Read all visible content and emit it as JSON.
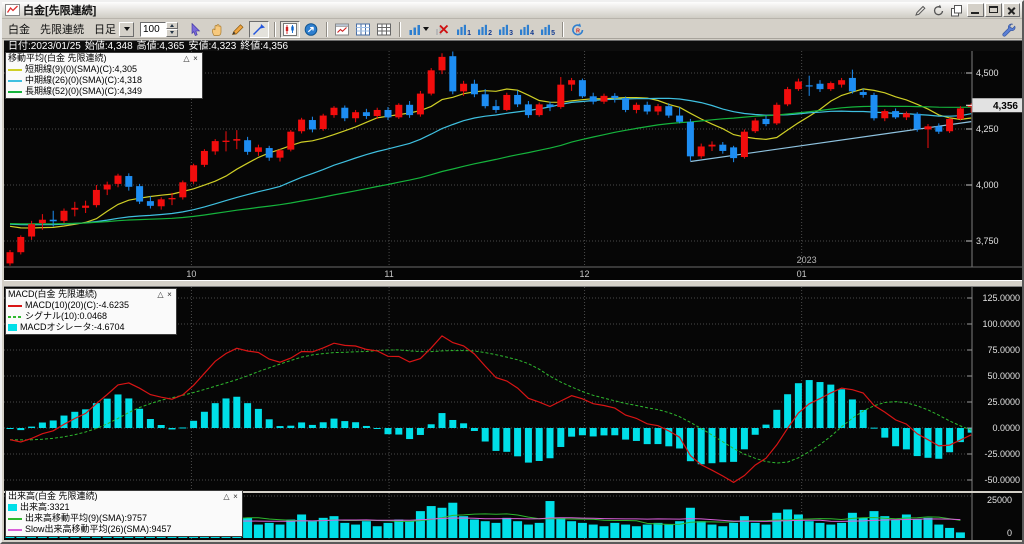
{
  "window": {
    "title": "白金[先限連続]",
    "controls": {
      "minimize": "minimize",
      "maximize": "maximize",
      "close": "close"
    }
  },
  "toolbar": {
    "symbol": "白金",
    "series": "先限連続",
    "period": "日足",
    "bars_count": "100",
    "tools": [
      {
        "name": "cursor-tool",
        "icon": "cursor"
      },
      {
        "name": "hand-pan-tool",
        "icon": "hand"
      },
      {
        "name": "pencil-draw-tool",
        "icon": "pencil"
      },
      {
        "name": "trendline-tool",
        "icon": "trend-arrow",
        "pressed": true
      },
      {
        "sep": true
      },
      {
        "name": "candle-chart-mode",
        "icon": "candle-chart",
        "pressed": true
      },
      {
        "name": "navigate-tool",
        "icon": "circle-arrow"
      },
      {
        "sep": true
      },
      {
        "name": "new-chart-window",
        "icon": "chart-window"
      },
      {
        "name": "layout-columns",
        "icon": "table-columns"
      },
      {
        "name": "layout-grid",
        "icon": "table-grid"
      },
      {
        "sep": true
      },
      {
        "name": "add-indicator-dropdown",
        "icon": "bar-chart-arrow",
        "dropdown": true
      },
      {
        "name": "remove-indicator",
        "icon": "chart-x"
      },
      {
        "name": "chart-preset-1",
        "icon": "chart-badge",
        "badge": "1"
      },
      {
        "name": "chart-preset-2",
        "icon": "chart-badge",
        "badge": "2"
      },
      {
        "name": "chart-preset-3",
        "icon": "chart-badge",
        "badge": "3"
      },
      {
        "name": "chart-preset-4",
        "icon": "chart-badge",
        "badge": "4"
      },
      {
        "name": "chart-preset-5",
        "icon": "chart-badge",
        "badge": "5"
      },
      {
        "sep": true
      },
      {
        "name": "reload-chart",
        "icon": "refresh"
      }
    ]
  },
  "info_bar": {
    "segments": [
      "日付:2023/01/25",
      "始値:4,348",
      "高値:4,365",
      "安値:4,323",
      "終値:4,356"
    ]
  },
  "legends": {
    "ma": {
      "title": "移動平均(白金 先限連続)",
      "items": [
        {
          "label": "短期線(9)(0)(SMA)(C):4,305",
          "color": "#cfcf26",
          "swatch": "line"
        },
        {
          "label": "中期線(26)(0)(SMA)(C):4,318",
          "color": "#3fc0e0",
          "swatch": "line"
        },
        {
          "label": "長期線(52)(0)(SMA)(C):4,349",
          "color": "#15b33c",
          "swatch": "line"
        }
      ]
    },
    "macd": {
      "title": "MACD(白金 先限連続)",
      "items": [
        {
          "label": "MACD(10)(20)(C):-4.6235",
          "color": "#d81414",
          "swatch": "line"
        },
        {
          "label": "シグナル(10):0.0468",
          "color": "#2eb82e",
          "swatch": "dash"
        },
        {
          "label": "MACDオシレータ:-4.6704",
          "color": "#00dfe8",
          "swatch": "bar"
        }
      ]
    },
    "volume": {
      "title": "出来高(白金 先限連続)",
      "items": [
        {
          "label": "出来高:3321",
          "color": "#00dfe8",
          "swatch": "bar"
        },
        {
          "label": "出来高移動平均(9)(SMA):9757",
          "color": "#2eb82e",
          "swatch": "line"
        },
        {
          "label": "Slow出来高移動平均(26)(SMA):9457",
          "color": "#d95fd9",
          "swatch": "line"
        }
      ]
    }
  },
  "axes": {
    "main": {
      "ticks": [
        {
          "label": "4,500",
          "value": 4500
        },
        {
          "label": "4,250",
          "value": 4250
        },
        {
          "label": "4,000",
          "value": 4000
        },
        {
          "label": "3,750",
          "value": 3750
        }
      ],
      "last_price": {
        "label": "4,356",
        "value": 4356
      }
    },
    "macd": {
      "ticks": [
        {
          "label": "125.0000",
          "value": 125
        },
        {
          "label": "100.0000",
          "value": 100
        },
        {
          "label": "75.0000",
          "value": 75
        },
        {
          "label": "50.0000",
          "value": 50
        },
        {
          "label": "25.0000",
          "value": 25
        },
        {
          "label": "0.0000",
          "value": 0
        },
        {
          "label": "-25.0000",
          "value": -25
        },
        {
          "label": "-50.0000",
          "value": -50
        }
      ]
    },
    "volume": {
      "ticks": [
        {
          "label": "25000",
          "value": 25000
        },
        {
          "label": "0",
          "value": 0
        }
      ]
    },
    "x": {
      "months": [
        {
          "label": "10",
          "index": 16.8
        },
        {
          "label": "11",
          "index": 35.1
        },
        {
          "label": "12",
          "index": 53.2
        },
        {
          "label": "01",
          "index": 73.3
        }
      ],
      "year": {
        "label": "2023",
        "index": 73.3
      }
    }
  },
  "chart_data": [
    {
      "type": "candlestick",
      "title": "白金 先限連続 日足",
      "up_color": "#f20d0d",
      "down_color": "#1d8df2",
      "ylim": [
        3638,
        4598
      ],
      "y_gridlines": [
        4500,
        4250,
        4000,
        3750
      ],
      "last_close": 4356,
      "ohlc": [
        [
          3650,
          3710,
          3640,
          3700
        ],
        [
          3700,
          3775,
          3690,
          3768
        ],
        [
          3770,
          3840,
          3755,
          3825
        ],
        [
          3830,
          3870,
          3800,
          3845
        ],
        [
          3845,
          3885,
          3815,
          3838
        ],
        [
          3840,
          3895,
          3830,
          3885
        ],
        [
          3890,
          3925,
          3860,
          3898
        ],
        [
          3898,
          3930,
          3875,
          3908
        ],
        [
          3910,
          4000,
          3900,
          3978
        ],
        [
          3980,
          4015,
          3955,
          4002
        ],
        [
          4005,
          4050,
          3990,
          4042
        ],
        [
          4040,
          4052,
          3975,
          3992
        ],
        [
          3995,
          4005,
          3915,
          3926
        ],
        [
          3928,
          3950,
          3895,
          3907
        ],
        [
          3905,
          3945,
          3890,
          3936
        ],
        [
          3936,
          3965,
          3910,
          3942
        ],
        [
          3945,
          4020,
          3935,
          4012
        ],
        [
          4015,
          4095,
          4005,
          4088
        ],
        [
          4090,
          4160,
          4080,
          4152
        ],
        [
          4150,
          4205,
          4135,
          4196
        ],
        [
          4192,
          4240,
          4150,
          4198
        ],
        [
          4198,
          4245,
          4160,
          4205
        ],
        [
          4200,
          4215,
          4135,
          4148
        ],
        [
          4148,
          4180,
          4130,
          4168
        ],
        [
          4165,
          4175,
          4108,
          4122
        ],
        [
          4122,
          4162,
          4105,
          4155
        ],
        [
          4158,
          4245,
          4150,
          4238
        ],
        [
          4240,
          4300,
          4230,
          4292
        ],
        [
          4290,
          4305,
          4235,
          4248
        ],
        [
          4250,
          4318,
          4242,
          4310
        ],
        [
          4312,
          4352,
          4300,
          4345
        ],
        [
          4345,
          4355,
          4285,
          4298
        ],
        [
          4298,
          4335,
          4280,
          4325
        ],
        [
          4325,
          4340,
          4295,
          4308
        ],
        [
          4308,
          4345,
          4295,
          4335
        ],
        [
          4335,
          4348,
          4290,
          4302
        ],
        [
          4302,
          4365,
          4295,
          4358
        ],
        [
          4358,
          4375,
          4300,
          4312
        ],
        [
          4315,
          4420,
          4305,
          4408
        ],
        [
          4408,
          4522,
          4400,
          4512
        ],
        [
          4512,
          4588,
          4495,
          4572
        ],
        [
          4575,
          4600,
          4405,
          4418
        ],
        [
          4418,
          4465,
          4398,
          4452
        ],
        [
          4452,
          4470,
          4392,
          4405
        ],
        [
          4405,
          4428,
          4342,
          4352
        ],
        [
          4352,
          4380,
          4322,
          4335
        ],
        [
          4335,
          4412,
          4330,
          4402
        ],
        [
          4402,
          4422,
          4348,
          4360
        ],
        [
          4360,
          4375,
          4300,
          4312
        ],
        [
          4312,
          4368,
          4305,
          4360
        ],
        [
          4360,
          4372,
          4330,
          4348
        ],
        [
          4348,
          4482,
          4340,
          4448
        ],
        [
          4448,
          4478,
          4420,
          4468
        ],
        [
          4468,
          4475,
          4388,
          4396
        ],
        [
          4396,
          4412,
          4360,
          4372
        ],
        [
          4372,
          4408,
          4362,
          4398
        ],
        [
          4398,
          4410,
          4368,
          4388
        ],
        [
          4388,
          4395,
          4325,
          4335
        ],
        [
          4335,
          4368,
          4320,
          4358
        ],
        [
          4358,
          4372,
          4315,
          4328
        ],
        [
          4328,
          4362,
          4312,
          4352
        ],
        [
          4352,
          4365,
          4300,
          4310
        ],
        [
          4310,
          4348,
          4275,
          4282
        ],
        [
          4282,
          4295,
          4108,
          4128
        ],
        [
          4128,
          4185,
          4118,
          4172
        ],
        [
          4172,
          4195,
          4152,
          4180
        ],
        [
          4180,
          4192,
          4140,
          4152
        ],
        [
          4168,
          4175,
          4102,
          4120
        ],
        [
          4125,
          4248,
          4118,
          4238
        ],
        [
          4240,
          4298,
          4232,
          4288
        ],
        [
          4295,
          4310,
          4262,
          4272
        ],
        [
          4275,
          4368,
          4268,
          4358
        ],
        [
          4360,
          4438,
          4352,
          4428
        ],
        [
          4428,
          4475,
          4420,
          4462
        ],
        [
          4445,
          4488,
          4398,
          4442
        ],
        [
          4452,
          4468,
          4415,
          4428
        ],
        [
          4428,
          4462,
          4420,
          4455
        ],
        [
          4448,
          4478,
          4435,
          4468
        ],
        [
          4478,
          4515,
          4408,
          4418
        ],
        [
          4415,
          4430,
          4390,
          4402
        ],
        [
          4402,
          4412,
          4288,
          4298
        ],
        [
          4298,
          4338,
          4285,
          4330
        ],
        [
          4330,
          4342,
          4295,
          4302
        ],
        [
          4302,
          4328,
          4290,
          4320
        ],
        [
          4318,
          4325,
          4238,
          4248
        ],
        [
          4248,
          4272,
          4165,
          4262
        ],
        [
          4262,
          4275,
          4228,
          4238
        ],
        [
          4240,
          4300,
          4232,
          4295
        ],
        [
          4295,
          4352,
          4288,
          4342
        ],
        [
          4348,
          4365,
          4323,
          4356
        ]
      ],
      "moving_averages": [
        {
          "label": "短期線",
          "period": 9,
          "color": "#cfcf26",
          "last_value": 4305
        },
        {
          "label": "中期線",
          "period": 26,
          "color": "#3fc0e0",
          "last_value": 4318
        },
        {
          "label": "長期線",
          "period": 52,
          "color": "#15b33c",
          "last_value": 4349
        }
      ],
      "ma_seed": 3830,
      "trendline": {
        "from_index": 63,
        "from_price": 4105,
        "to_index": 89,
        "to_price": 4283,
        "color": "#8fc3e0"
      }
    },
    {
      "type": "line",
      "subtype": "macd",
      "derived_from": "candlestick closes",
      "params": {
        "fast": 10,
        "slow": 20,
        "signal": 10
      },
      "line_color": "#d81414",
      "signal_color": "#2eb82e",
      "osc_color": "#00dfe8",
      "current": {
        "macd": -4.6235,
        "signal": 0.0468,
        "oscillator": -4.6704
      },
      "ylim": [
        -58,
        134
      ],
      "y_gridlines": [
        125,
        100,
        75,
        50,
        25,
        0,
        -25,
        -50
      ]
    },
    {
      "type": "bar",
      "subtype": "volume",
      "bar_color": "#00dfe8",
      "ylim": [
        0,
        25000
      ],
      "current": 3321,
      "values": [
        9000,
        8000,
        11000,
        7000,
        6000,
        8000,
        7000,
        9000,
        12000,
        8000,
        10000,
        13000,
        9000,
        7000,
        8000,
        16000,
        12000,
        14000,
        17000,
        11000,
        9000,
        10000,
        12000,
        8000,
        9000,
        8000,
        11000,
        14000,
        10000,
        12000,
        13000,
        9000,
        8000,
        10000,
        7000,
        9000,
        11000,
        10000,
        16000,
        19000,
        18000,
        21000,
        13000,
        11000,
        10000,
        9000,
        12000,
        10000,
        8000,
        9000,
        22000,
        12000,
        10000,
        9000,
        8000,
        7000,
        9000,
        8000,
        7000,
        8000,
        9000,
        8000,
        10000,
        18000,
        10000,
        8000,
        7000,
        9000,
        13000,
        9000,
        8000,
        15000,
        17000,
        14000,
        10000,
        9000,
        8000,
        9000,
        15000,
        12000,
        16000,
        13000,
        11000,
        14000,
        11000,
        12000,
        8000,
        6000,
        3321
      ],
      "moving_averages": [
        {
          "label": "出来高移動平均",
          "period": 9,
          "color": "#2eb82e",
          "last_value": 9757
        },
        {
          "label": "Slow出来高移動平均",
          "period": 26,
          "color": "#d95fd9",
          "last_value": 9457
        }
      ]
    }
  ]
}
